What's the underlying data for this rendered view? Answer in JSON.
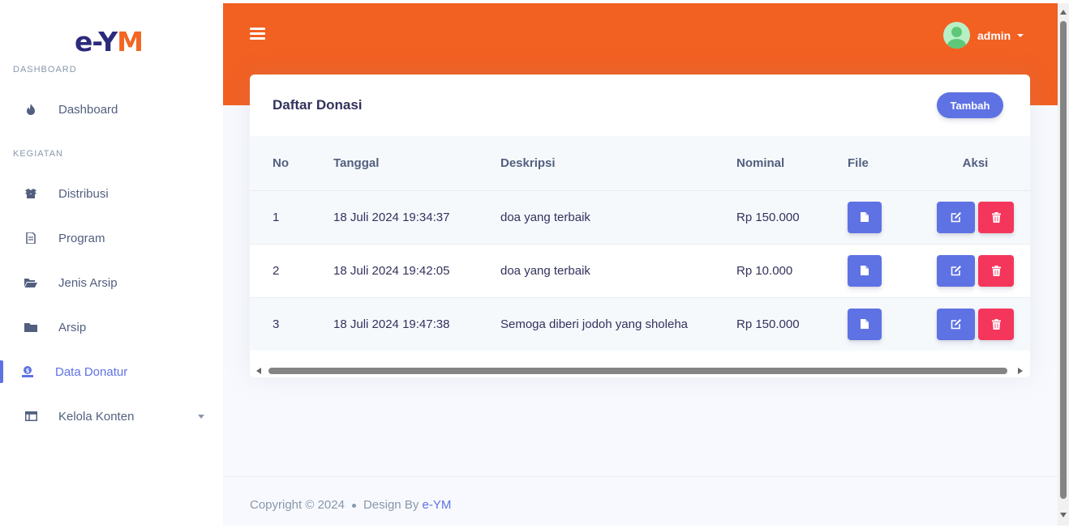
{
  "brand": {
    "logo_e": "e-",
    "logo_y": "Y",
    "logo_m": "M"
  },
  "sidebar": {
    "sections": [
      {
        "label": "DASHBOARD"
      },
      {
        "label": "KEGIATAN"
      }
    ],
    "items": [
      {
        "label": "Dashboard",
        "icon": "fire-icon"
      },
      {
        "label": "Distribusi",
        "icon": "box-icon"
      },
      {
        "label": "Program",
        "icon": "document-icon"
      },
      {
        "label": "Jenis Arsip",
        "icon": "folder-open-icon"
      },
      {
        "label": "Arsip",
        "icon": "folder-icon"
      },
      {
        "label": "Data Donatur",
        "icon": "money-icon",
        "active": true
      },
      {
        "label": "Kelola Konten",
        "icon": "layout-icon",
        "has_submenu": true
      }
    ]
  },
  "header": {
    "user_name": "admin"
  },
  "card": {
    "title": "Daftar Donasi",
    "add_button": "Tambah"
  },
  "table": {
    "columns": [
      "No",
      "Tanggal",
      "Deskripsi",
      "Nominal",
      "File",
      "Aksi"
    ],
    "rows": [
      {
        "no": "1",
        "tanggal": "18 Juli 2024 19:34:37",
        "deskripsi": "doa yang terbaik",
        "nominal": "Rp 150.000"
      },
      {
        "no": "2",
        "tanggal": "18 Juli 2024 19:42:05",
        "deskripsi": "doa yang terbaik",
        "nominal": "Rp 10.000"
      },
      {
        "no": "3",
        "tanggal": "18 Juli 2024 19:47:38",
        "deskripsi": "Semoga diberi jodoh yang sholeha",
        "nominal": "Rp 150.000"
      }
    ]
  },
  "footer": {
    "copyright": "Copyright © 2024",
    "design_by": "Design By",
    "brand": "e-YM"
  },
  "colors": {
    "accent": "#5e72e4",
    "header": "#f26022",
    "danger": "#f5365c"
  }
}
